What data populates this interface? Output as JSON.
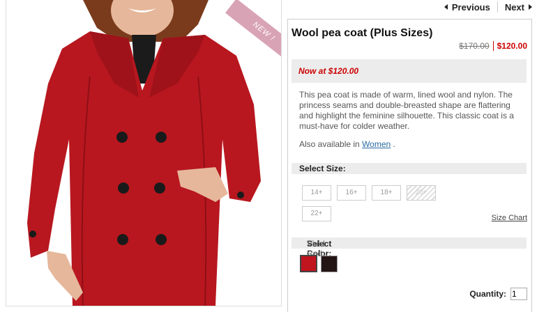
{
  "nav": {
    "previous": "Previous",
    "next": "Next"
  },
  "image": {
    "badge": "NEW !"
  },
  "product": {
    "title": "Wool pea coat (Plus Sizes)",
    "old_price": "$170.00",
    "price": "$120.00",
    "now_at": "Now at $120.00",
    "description": "This pea coat is made of warm, lined wool and nylon. The princess seams and double-breasted shape are flattering and highlight the feminine silhouette. This classic coat is a must-have for colder weather.",
    "also_prefix": "Also available in",
    "also_link": "Women",
    "also_suffix": "."
  },
  "size": {
    "label": "Select Size:",
    "options": [
      "14+",
      "16+",
      "18+",
      "20+",
      "22+"
    ],
    "unavailable": [
      "20+"
    ],
    "chart_link": "Size Chart"
  },
  "color": {
    "label": "Select Color:",
    "selected": "Vivid Red",
    "swatches": [
      {
        "name": "red",
        "hex": "#c0141f"
      },
      {
        "name": "black",
        "hex": "#231415"
      }
    ]
  },
  "quantity": {
    "label": "Quantity:",
    "value": "1"
  },
  "colors": {
    "accent_red": "#cc0000",
    "link_blue": "#2a6aa0",
    "coat_red": "#b8171f"
  }
}
